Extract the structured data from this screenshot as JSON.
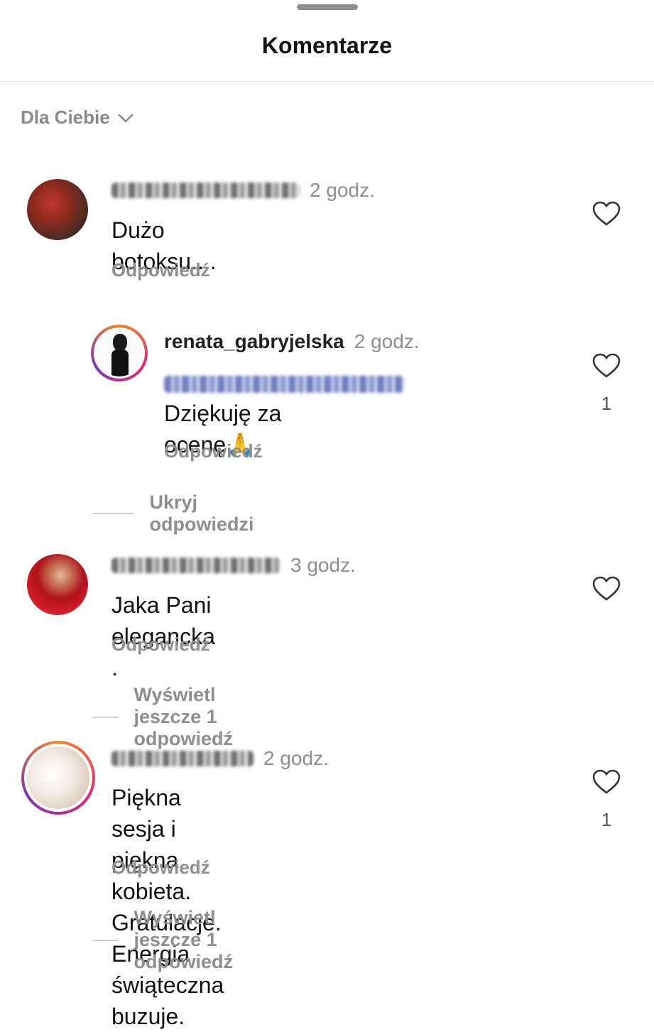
{
  "sheet": {
    "title": "Komentarze",
    "sort_label": "Dla Ciebie"
  },
  "comments": [
    {
      "time": "2 godz.",
      "text": "Dużo botoksu....",
      "reply_label": "Odpowiedź",
      "likes": ""
    },
    {
      "time": "3 godz.",
      "text": "Jaka Pani elegancka .",
      "reply_label": "Odpowiedź",
      "likes": "",
      "thread_label": "Wyświetl jeszcze 1 odpowiedź"
    },
    {
      "time": "2 godz.",
      "text_line1": "Piękna sesja i piękna kobieta.",
      "text_line2": "Gratulacje. Energia świąteczna buzuje.",
      "reply_label": "Odpowiedź",
      "likes": "1",
      "thread_label": "Wyświetl jeszcze 1 odpowiedź"
    }
  ],
  "reply": {
    "username": "renata_gabryjelska",
    "time": "2 godz.",
    "text_after_mention": "Dziękuję za",
    "text_line2": "ocenę🙏",
    "reply_label": "Odpowiedź",
    "likes": "1",
    "hide_label": "Ukryj odpowiedzi"
  },
  "icons": {
    "like": "heart-outline-icon",
    "sort": "chevron-down-icon"
  }
}
